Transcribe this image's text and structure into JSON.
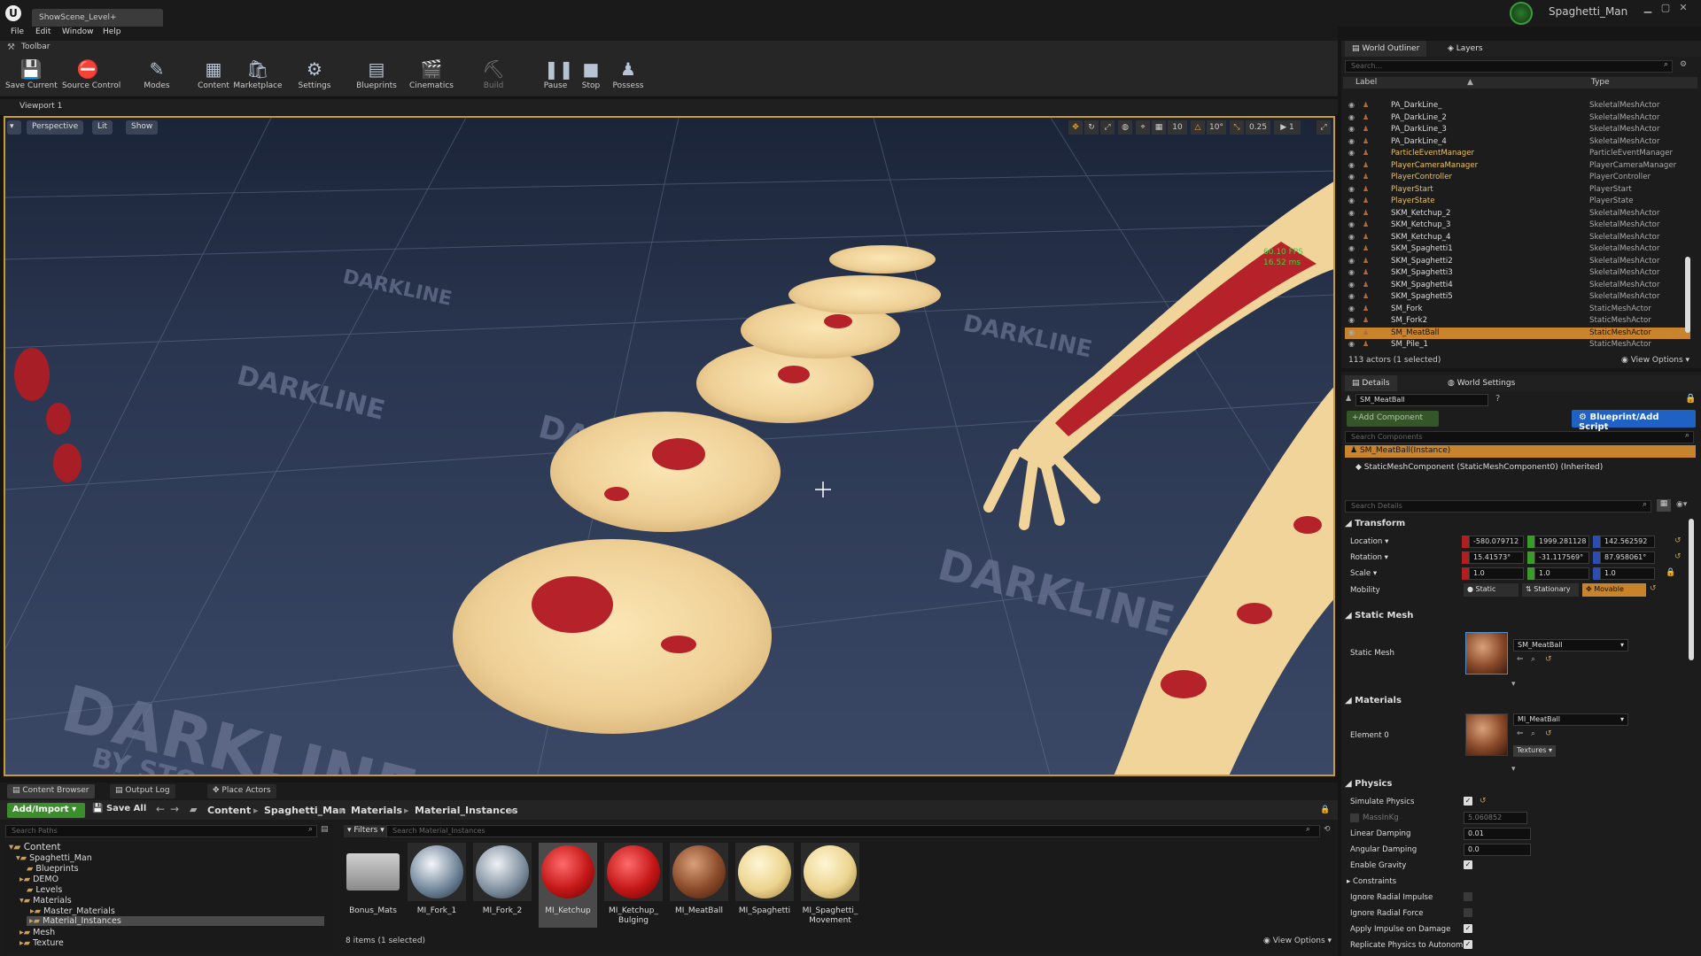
{
  "window": {
    "doc_tab": "ShowScene_Level+",
    "project_name": "Spaghetti_Man"
  },
  "menu": [
    "File",
    "Edit",
    "Window",
    "Help"
  ],
  "toolbar": {
    "header": "Toolbar",
    "buttons": [
      "Save Current",
      "Source Control",
      "Modes",
      "Content",
      "Marketplace",
      "Settings",
      "Blueprints",
      "Cinematics",
      "Build",
      "Pause",
      "Stop",
      "Possess"
    ]
  },
  "viewport": {
    "tab": "Viewport 1",
    "perspective": "Perspective",
    "lit": "Lit",
    "show": "Show",
    "grid_snap": "10",
    "rot_snap": "10°",
    "scale_snap": "0.25",
    "camera_speed": "1",
    "fps": "60.10 FPS",
    "ms": "16.52 ms",
    "floor_brand": "DARKLINE",
    "floor_sub": "BY STOCKLANCER"
  },
  "bottom_tabs": [
    "Content Browser",
    "Output Log",
    "Place Actors"
  ],
  "content_browser": {
    "add_import": "Add/Import",
    "save_all": "Save All",
    "breadcrumb": [
      "Content",
      "Spaghetti_Man",
      "Materials",
      "Material_Instances"
    ],
    "search_paths": "Search Paths",
    "filters": "Filters",
    "search_assets": "Search Material_Instances",
    "tree": [
      {
        "label": "Content",
        "level": 0
      },
      {
        "label": "Spaghetti_Man",
        "level": 1
      },
      {
        "label": "Blueprints",
        "level": 2
      },
      {
        "label": "DEMO",
        "level": 2
      },
      {
        "label": "Levels",
        "level": 2
      },
      {
        "label": "Materials",
        "level": 2
      },
      {
        "label": "Master_Materials",
        "level": 3
      },
      {
        "label": "Material_Instances",
        "level": 3
      },
      {
        "label": "Mesh",
        "level": 2
      },
      {
        "label": "Texture",
        "level": 2
      }
    ],
    "assets": [
      {
        "label": "Bonus_Mats",
        "kind": "folder"
      },
      {
        "label": "MI_Fork_1",
        "kind": "metal"
      },
      {
        "label": "MI_Fork_2",
        "kind": "metal"
      },
      {
        "label": "MI_Ketchup",
        "kind": "red"
      },
      {
        "label": "MI_Ketchup_ Bulging",
        "kind": "red"
      },
      {
        "label": "MI_MeatBall",
        "kind": "meat"
      },
      {
        "label": "MI_Spaghetti",
        "kind": "pasta"
      },
      {
        "label": "MI_Spaghetti_ Movement",
        "kind": "pasta"
      }
    ],
    "status": "8 items (1 selected)",
    "view_options": "View Options"
  },
  "outliner": {
    "tab": "World Outliner",
    "tab2": "Layers",
    "search": "Search...",
    "col_label": "Label",
    "col_type": "Type",
    "rows": [
      {
        "label": "PA_DarkLine_",
        "type": "SkeletalMeshActor"
      },
      {
        "label": "PA_DarkLine_2",
        "type": "SkeletalMeshActor"
      },
      {
        "label": "PA_DarkLine_3",
        "type": "SkeletalMeshActor"
      },
      {
        "label": "PA_DarkLine_4",
        "type": "SkeletalMeshActor"
      },
      {
        "label": "ParticleEventManager",
        "type": "ParticleEventManager"
      },
      {
        "label": "PlayerCameraManager",
        "type": "PlayerCameraManager"
      },
      {
        "label": "PlayerController",
        "type": "PlayerController"
      },
      {
        "label": "PlayerStart",
        "type": "PlayerStart"
      },
      {
        "label": "PlayerState",
        "type": "PlayerState"
      },
      {
        "label": "SKM_Ketchup_2",
        "type": "SkeletalMeshActor"
      },
      {
        "label": "SKM_Ketchup_3",
        "type": "SkeletalMeshActor"
      },
      {
        "label": "SKM_Ketchup_4",
        "type": "SkeletalMeshActor"
      },
      {
        "label": "SKM_Spaghetti1",
        "type": "SkeletalMeshActor"
      },
      {
        "label": "SKM_Spaghetti2",
        "type": "SkeletalMeshActor"
      },
      {
        "label": "SKM_Spaghetti3",
        "type": "SkeletalMeshActor"
      },
      {
        "label": "SKM_Spaghetti4",
        "type": "SkeletalMeshActor"
      },
      {
        "label": "SKM_Spaghetti5",
        "type": "SkeletalMeshActor"
      },
      {
        "label": "SM_Fork",
        "type": "StaticMeshActor"
      },
      {
        "label": "SM_Fork2",
        "type": "StaticMeshActor"
      },
      {
        "label": "SM_MeatBall",
        "type": "StaticMeshActor"
      },
      {
        "label": "SM_Pile_1",
        "type": "StaticMeshActor"
      }
    ],
    "status": "113 actors (1 selected)",
    "view_options": "View Options"
  },
  "details": {
    "tab": "Details",
    "tab2": "World Settings",
    "actor_name": "SM_MeatBall",
    "add_component": "+Add Component",
    "blueprint_btn": "Blueprint/Add Script",
    "search_components": "Search Components",
    "instance": "SM_MeatBall(Instance)",
    "component": "StaticMeshComponent (StaticMeshComponent0) (Inherited)",
    "search_details": "Search Details",
    "transform": "Transform",
    "location_label": "Location",
    "location": [
      "-580.079712",
      "1999.281128",
      "142.562592"
    ],
    "rotation_label": "Rotation",
    "rotation": [
      "15.41573°",
      "-31.117569°",
      "87.958061°"
    ],
    "scale_label": "Scale",
    "scale": [
      "1.0",
      "1.0",
      "1.0"
    ],
    "mobility_label": "Mobility",
    "mobility": [
      "Static",
      "Stationary",
      "Movable"
    ],
    "static_mesh_section": "Static Mesh",
    "static_mesh_label": "Static Mesh",
    "static_mesh_value": "SM_MeatBall",
    "materials_section": "Materials",
    "element0_label": "Element 0",
    "element0_value": "MI_MeatBall",
    "textures": "Textures",
    "physics_section": "Physics",
    "physics": [
      {
        "label": "Simulate Physics",
        "checked": true
      },
      {
        "label": "MassInKg",
        "value": "5.060852"
      },
      {
        "label": "Linear Damping",
        "value": "0.01"
      },
      {
        "label": "Angular Damping",
        "value": "0.0"
      },
      {
        "label": "Enable Gravity",
        "checked": true
      },
      {
        "label": "Constraints"
      },
      {
        "label": "Ignore Radial Impulse",
        "checked": false
      },
      {
        "label": "Ignore Radial Force",
        "checked": false
      },
      {
        "label": "Apply Impulse on Damage",
        "checked": true
      },
      {
        "label": "Replicate Physics to Autonomou",
        "checked": true
      }
    ]
  },
  "colors": {
    "accent": "#c89b2a",
    "selection": "#c7842c",
    "add_green": "#3b8f2a",
    "blueprint_blue": "#1f62c4"
  }
}
